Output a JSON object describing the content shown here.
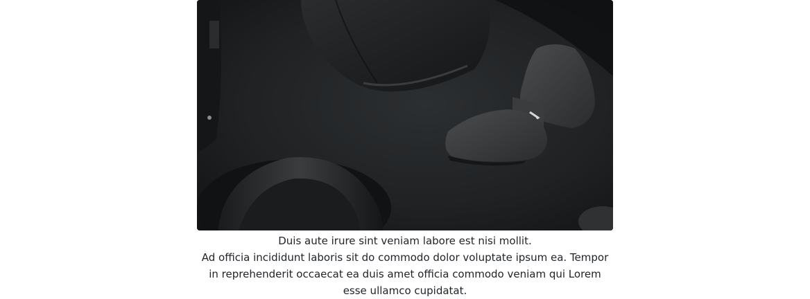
{
  "carousel": {
    "slide": {
      "image_subject": "dark-desk-accessories-photo",
      "caption_title": "Duis aute irure sint veniam labore est nisi mollit.",
      "caption_text": "Ad officia incididunt laboris sit do commodo dolor voluptate ipsum ea. Tempor in reprehenderit occaecat ea duis amet officia commodo veniam qui Lorem esse ullamco cupidatat."
    }
  }
}
